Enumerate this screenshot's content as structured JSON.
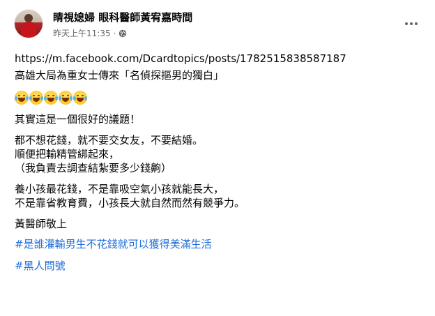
{
  "post": {
    "author": "睛視媳婦 眼科醫師黃宥嘉時間",
    "timestamp": "昨天上午11:35",
    "separator": "·",
    "privacy_icon": "globe-icon",
    "more_icon": "more-options-icon",
    "link": "https://m.facebook.com/Dcardtopics/posts/1782515838587187",
    "line_title": "高雄大局為重女士傳來「名偵探摳男的獨白」",
    "emojis": [
      "😂",
      "😂",
      "😂",
      "😂",
      "😂"
    ],
    "para1": "其實這是一個很好的議題！",
    "para2": [
      "都不想花錢，就不要交女友，不要結婚。",
      "順便把輸精管綁起來，",
      "（我負責去調查結紮要多少錢齁）"
    ],
    "para3": [
      "養小孩最花錢，不是靠吸空氣小孩就能長大，",
      "不是靠省教育費，小孩長大就自然而然有競爭力。"
    ],
    "signature": "黃醫師敬上",
    "hashtags": [
      "#是誰灌輸男生不花錢就可以獲得美滿生活",
      "#黑人問號"
    ]
  },
  "colors": {
    "hashtag": "#216fdb",
    "meta": "#65676b",
    "text": "#050505"
  }
}
